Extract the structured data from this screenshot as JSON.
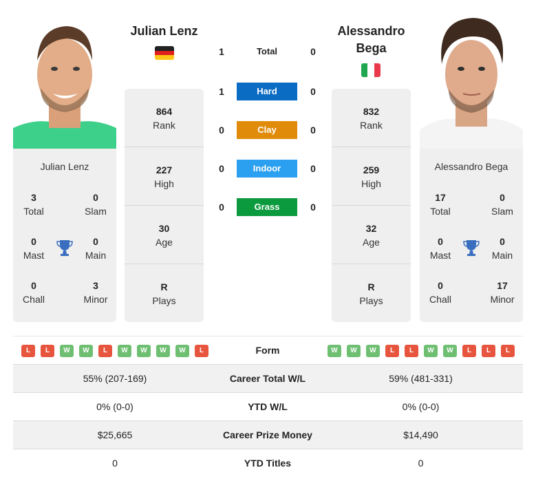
{
  "player1": {
    "name": "Julian Lenz",
    "country_flag": "germany-flag",
    "photo": "player-photo-julian-lenz",
    "stats": [
      {
        "value": "864",
        "label": "Rank"
      },
      {
        "value": "227",
        "label": "High"
      },
      {
        "value": "30",
        "label": "Age"
      },
      {
        "value": "R",
        "label": "Plays"
      }
    ],
    "titles": {
      "name": "Julian Lenz",
      "total": {
        "value": "3",
        "label": "Total"
      },
      "slam": {
        "value": "0",
        "label": "Slam"
      },
      "mast": {
        "value": "0",
        "label": "Mast"
      },
      "main": {
        "value": "0",
        "label": "Main"
      },
      "chall": {
        "value": "0",
        "label": "Chall"
      },
      "minor": {
        "value": "3",
        "label": "Minor"
      }
    },
    "form": [
      "L",
      "L",
      "W",
      "W",
      "L",
      "W",
      "W",
      "W",
      "W",
      "L"
    ]
  },
  "player2": {
    "name": "Alessandro Bega",
    "country_flag": "italy-flag",
    "photo": "player-photo-alessandro-bega",
    "stats": [
      {
        "value": "832",
        "label": "Rank"
      },
      {
        "value": "259",
        "label": "High"
      },
      {
        "value": "32",
        "label": "Age"
      },
      {
        "value": "R",
        "label": "Plays"
      }
    ],
    "titles": {
      "name": "Alessandro Bega",
      "total": {
        "value": "17",
        "label": "Total"
      },
      "slam": {
        "value": "0",
        "label": "Slam"
      },
      "mast": {
        "value": "0",
        "label": "Mast"
      },
      "main": {
        "value": "0",
        "label": "Main"
      },
      "chall": {
        "value": "0",
        "label": "Chall"
      },
      "minor": {
        "value": "17",
        "label": "Minor"
      }
    },
    "form": [
      "W",
      "W",
      "W",
      "L",
      "L",
      "W",
      "W",
      "L",
      "L",
      "L"
    ]
  },
  "h2h": [
    {
      "label": "Total",
      "left": "1",
      "right": "0",
      "color": ""
    },
    {
      "label": "Hard",
      "left": "1",
      "right": "0",
      "color": "#0b6cc4"
    },
    {
      "label": "Clay",
      "left": "0",
      "right": "0",
      "color": "#e08c0a"
    },
    {
      "label": "Indoor",
      "left": "0",
      "right": "0",
      "color": "#2b9ff0"
    },
    {
      "label": "Grass",
      "left": "0",
      "right": "0",
      "color": "#0c9a3e"
    }
  ],
  "table": {
    "form_label": "Form",
    "rows": [
      {
        "left": "55% (207-169)",
        "label": "Career Total W/L",
        "right": "59% (481-331)"
      },
      {
        "left": "0% (0-0)",
        "label": "YTD W/L",
        "right": "0% (0-0)"
      },
      {
        "left": "$25,665",
        "label": "Career Prize Money",
        "right": "$14,490"
      },
      {
        "left": "0",
        "label": "YTD Titles",
        "right": "0"
      }
    ]
  },
  "colors": {
    "win": "#6fbf73",
    "loss": "#e8553e",
    "trophy": "#3a6fbf"
  }
}
